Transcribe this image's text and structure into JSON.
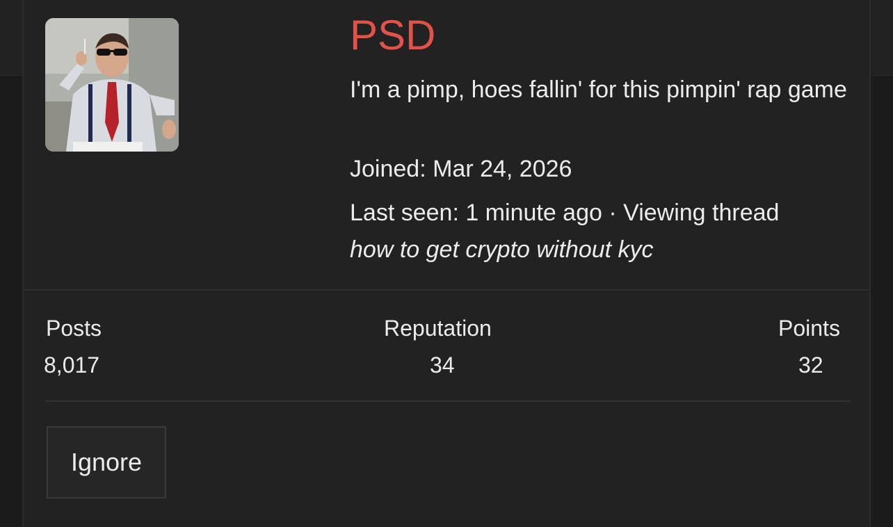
{
  "profile": {
    "username": "PSD",
    "user_title": "I'm a pimp, hoes fallin' for this pimpin' rap game",
    "joined": "Joined: Mar 24, 2026",
    "last_seen": "Last seen: 1 minute ago · Viewing thread",
    "thread_title": "how to get crypto without kyc",
    "username_color": "#e0524a"
  },
  "stats": {
    "posts_label": "Posts",
    "posts_value": "8,017",
    "reputation_label": "Reputation",
    "reputation_value": "34",
    "points_label": "Points",
    "points_value": "32"
  },
  "actions": {
    "ignore_label": "Ignore"
  }
}
